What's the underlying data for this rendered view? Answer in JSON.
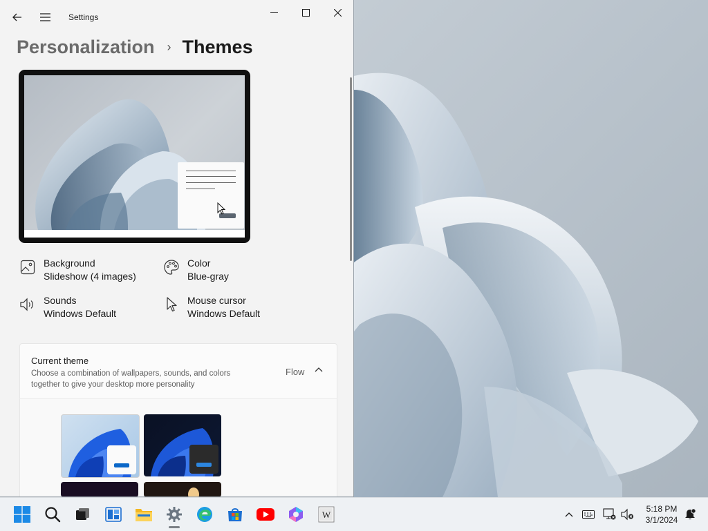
{
  "window": {
    "app_title": "Settings",
    "breadcrumb": {
      "parent": "Personalization",
      "separator": "›",
      "current": "Themes"
    }
  },
  "properties": [
    {
      "icon": "image-icon",
      "label": "Background",
      "value": "Slideshow (4 images)"
    },
    {
      "icon": "palette-icon",
      "label": "Color",
      "value": "Blue-gray"
    },
    {
      "icon": "speaker-icon",
      "label": "Sounds",
      "value": "Windows Default"
    },
    {
      "icon": "mouse-cursor-icon",
      "label": "Mouse cursor",
      "value": "Windows Default"
    }
  ],
  "current_theme": {
    "title": "Current theme",
    "description": "Choose a combination of wallpapers, sounds, and colors together to give your desktop more personality",
    "value": "Flow",
    "expanded": true,
    "themes": [
      "light-theme",
      "dark-theme",
      "glow-theme",
      "captured-motion-theme"
    ]
  },
  "taskbar": {
    "apps": [
      "start",
      "search",
      "task-view",
      "widgets",
      "file-explorer",
      "settings",
      "edge",
      "microsoft-store",
      "youtube",
      "copilot",
      "wikipedia"
    ],
    "active_app": "settings",
    "clock": {
      "time": "5:18 PM",
      "date": "3/1/2024"
    }
  },
  "colors": {
    "window_bg": "#f3f3f3",
    "accent": "#0a67c8",
    "taskbar_bg": "#eef1f4"
  }
}
